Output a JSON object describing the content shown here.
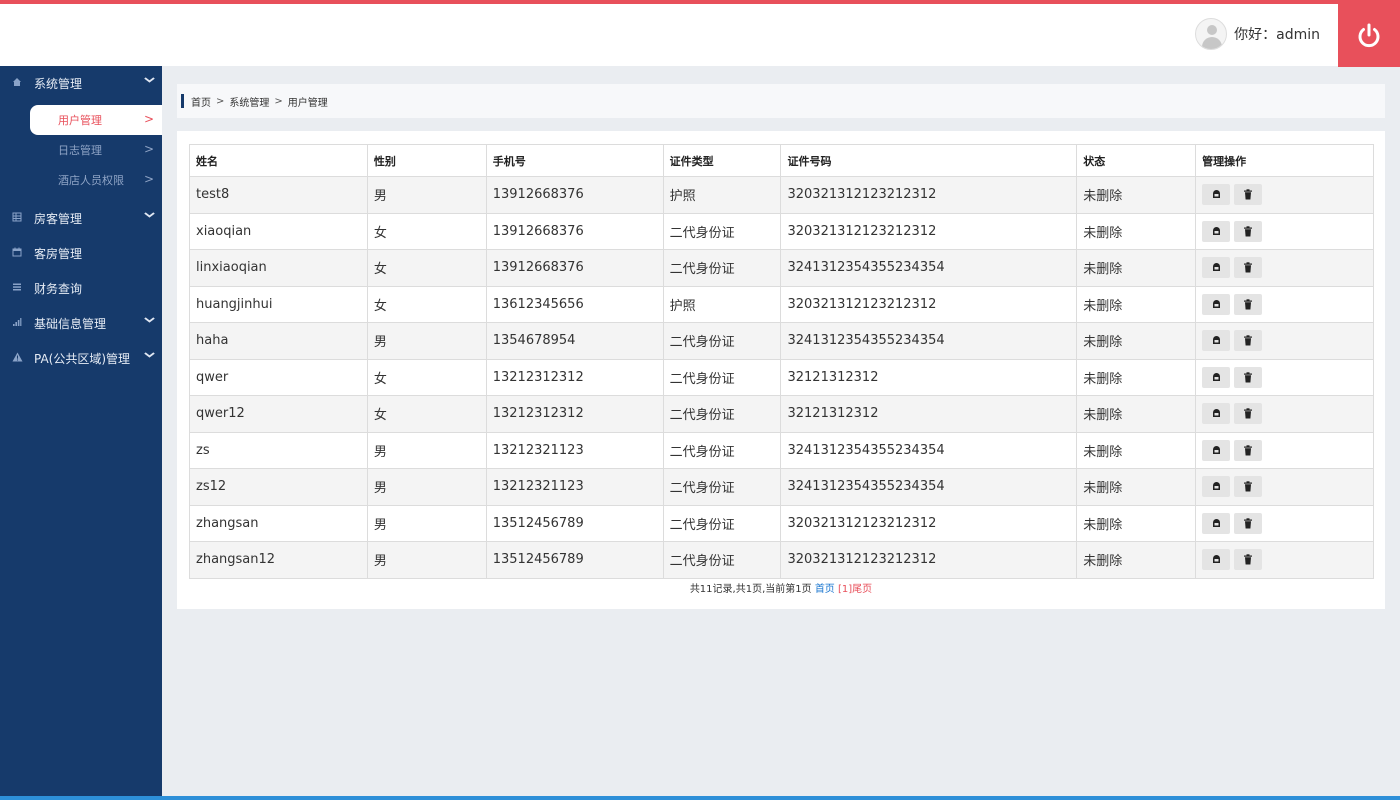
{
  "header": {
    "greeting": "你好：admin",
    "power_icon": "power-icon"
  },
  "sidebar": {
    "groups": [
      {
        "label": "系统管理",
        "icon": "home-icon",
        "expanded": true,
        "items": [
          {
            "label": "用户管理",
            "active": true
          },
          {
            "label": "日志管理"
          },
          {
            "label": "酒店人员权限"
          }
        ]
      },
      {
        "label": "房客管理",
        "icon": "grid-icon"
      },
      {
        "label": "客房管理",
        "icon": "calendar-icon"
      },
      {
        "label": "财务查询",
        "icon": "list-icon"
      },
      {
        "label": "基础信息管理",
        "icon": "signal-icon"
      },
      {
        "label": "PA(公共区域)管理",
        "icon": "warning-icon"
      }
    ]
  },
  "breadcrumb": {
    "items": [
      "首页",
      "系统管理",
      "用户管理"
    ],
    "separator": ">"
  },
  "table": {
    "headers": [
      "姓名",
      "性别",
      "手机号",
      "证件类型",
      "证件号码",
      "状态",
      "管理操作"
    ],
    "rows": [
      [
        "test8",
        "男",
        "13912668376",
        "护照",
        "320321312123212312",
        "未删除"
      ],
      [
        "xiaoqian",
        "女",
        "13912668376",
        "二代身份证",
        "320321312123212312",
        "未删除"
      ],
      [
        "linxiaoqian",
        "女",
        "13912668376",
        "二代身份证",
        "3241312354355234354",
        "未删除"
      ],
      [
        "huangjinhui",
        "女",
        "13612345656",
        "护照",
        "320321312123212312",
        "未删除"
      ],
      [
        "haha",
        "男",
        "1354678954",
        "二代身份证",
        "3241312354355234354",
        "未删除"
      ],
      [
        "qwer",
        "女",
        "13212312312",
        "二代身份证",
        "32121312312",
        "未删除"
      ],
      [
        "qwer12",
        "女",
        "13212312312",
        "二代身份证",
        "32121312312",
        "未删除"
      ],
      [
        "zs",
        "男",
        "13212321123",
        "二代身份证",
        "3241312354355234354",
        "未删除"
      ],
      [
        "zs12",
        "男",
        "13212321123",
        "二代身份证",
        "3241312354355234354",
        "未删除"
      ],
      [
        "zhangsan",
        "男",
        "13512456789",
        "二代身份证",
        "320321312123212312",
        "未删除"
      ],
      [
        "zhangsan12",
        "男",
        "13512456789",
        "二代身份证",
        "320321312123212312",
        "未删除"
      ]
    ],
    "actions": [
      {
        "icon": "edit-icon"
      },
      {
        "icon": "trash-icon"
      }
    ]
  },
  "pager": {
    "summary": "共11记录,共1页,当前第1页",
    "first": "首页",
    "current": "[1]",
    "last": "尾页"
  },
  "colors": {
    "accent": "#e8505b",
    "sidebar": "#163a6b",
    "link": "#1d78d0"
  }
}
